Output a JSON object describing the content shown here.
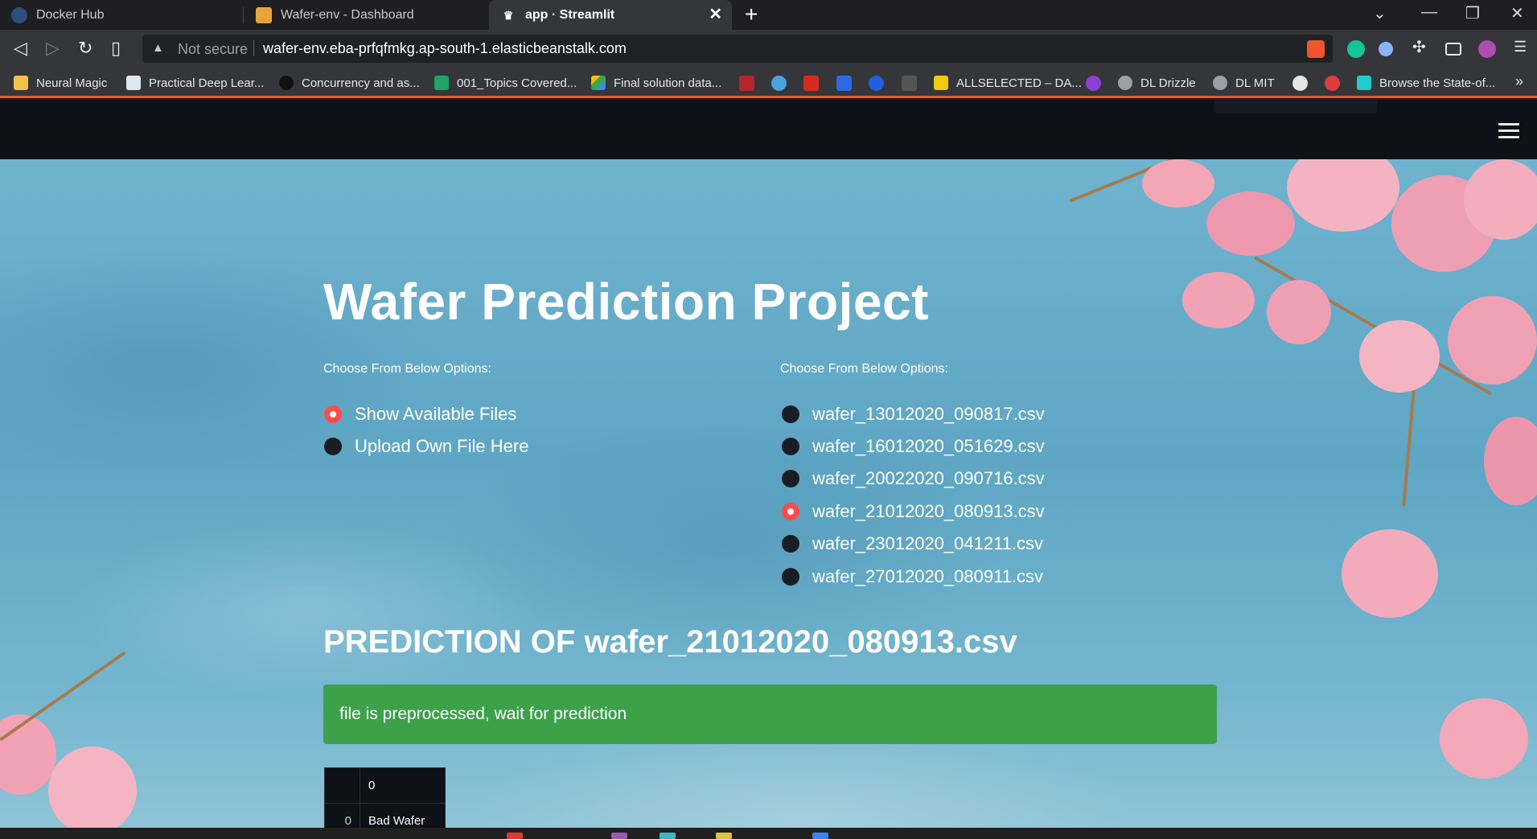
{
  "browser": {
    "tabs": [
      {
        "title": "Docker Hub",
        "icon": "docker-icon",
        "active": false
      },
      {
        "title": "Wafer-env - Dashboard",
        "icon": "aws-box-icon",
        "active": false
      },
      {
        "title": "app · Streamlit",
        "icon": "streamlit-crown-icon",
        "active": true
      }
    ],
    "address_bar": {
      "security": "Not secure",
      "url": "wafer-env.eba-prfqfmkg.ap-south-1.elasticbeanstalk.com"
    },
    "bookmarks": [
      {
        "label": "Neural Magic",
        "icon": "folder-icon"
      },
      {
        "label": "Practical Deep Lear...",
        "icon": "page-icon"
      },
      {
        "label": "Concurrency and as...",
        "icon": "lightning-icon"
      },
      {
        "label": "001_Topics Covered...",
        "icon": "sheets-icon"
      },
      {
        "label": "Final solution data...",
        "icon": "drive-icon"
      },
      {
        "label": "ALLSELECTED – DA...",
        "icon": "bars-icon"
      },
      {
        "label": "DL Drizzle",
        "icon": "globe-icon"
      },
      {
        "label": "DL MIT",
        "icon": "globe-icon"
      },
      {
        "label": "Browse the State-of...",
        "icon": "paperswithcode-icon"
      }
    ],
    "colors": {
      "accent_orange": "#e7562e",
      "tab_bg": "#1f1e23",
      "toolbar_bg": "#35363a"
    }
  },
  "app": {
    "title": "Wafer Prediction Project",
    "left_group": {
      "label": "Choose From Below Options:",
      "options": [
        "Show Available Files",
        "Upload Own File Here"
      ],
      "selected": 0
    },
    "right_group": {
      "label": "Choose From Below Options:",
      "options": [
        "wafer_13012020_090817.csv",
        "wafer_16012020_051629.csv",
        "wafer_20022020_090716.csv",
        "wafer_21012020_080913.csv",
        "wafer_23012020_041211.csv",
        "wafer_27012020_080911.csv"
      ],
      "selected": 3
    },
    "prediction_heading": "PREDICTION OF wafer_21012020_080913.csv",
    "status_message": "file is preprocessed, wait for prediction",
    "dataframe": {
      "columns": [
        "",
        "0"
      ],
      "rows": [
        [
          "0",
          "Bad Wafer"
        ]
      ]
    },
    "colors": {
      "radio_selected": "#ff4b4b",
      "success_bg": "#3da14a",
      "header_bg": "#0e1117"
    }
  }
}
